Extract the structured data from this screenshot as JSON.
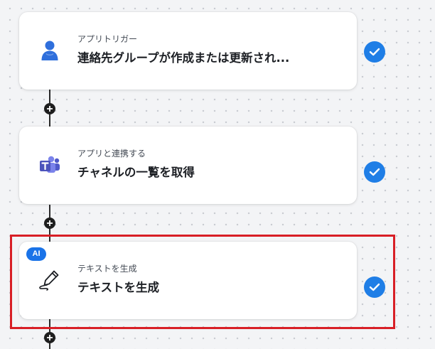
{
  "steps": [
    {
      "subtitle": "アプリトリガー",
      "title": "連絡先グループが作成または更新され...",
      "icon": "user-contact-icon",
      "status": "completed"
    },
    {
      "subtitle": "アプリと連携する",
      "title": "チャネルの一覧を取得",
      "icon": "microsoft-teams-icon",
      "status": "completed"
    },
    {
      "subtitle": "テキストを生成",
      "title": "テキストを生成",
      "icon": "pen-write-icon",
      "status": "completed",
      "badge": "AI",
      "highlighted": true
    }
  ],
  "colors": {
    "check": "#1f7ee6",
    "ai_badge": "#1a73e8",
    "highlight": "#d81f26",
    "teams": "#5b5fc7",
    "user_icon": "#2f6fdc"
  }
}
